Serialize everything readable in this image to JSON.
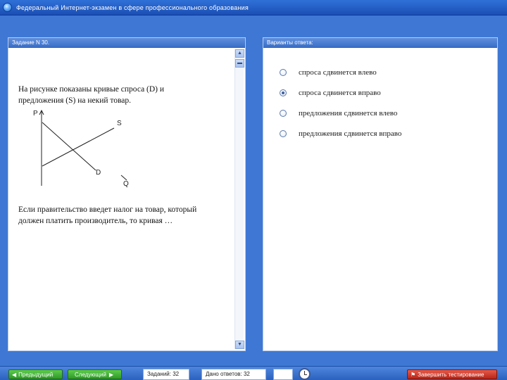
{
  "window": {
    "title": "Федеральный Интернет-экзамен в сфере профессионального образования",
    "icon": "app-globe-icon"
  },
  "task_panel": {
    "header": "Задание N 30.",
    "question_intro": "На рисунке показаны кривые спроса (D) и предложения (S) на некий товар.",
    "graph_labels": {
      "price": "P",
      "supply": "S",
      "demand": "D",
      "quantity": "Q"
    },
    "question_body": "Если правительство введет налог на товар, который должен платить производитель, то кривая …"
  },
  "answers_panel": {
    "header": "Варианты ответа:",
    "options": [
      {
        "label": "спроса сдвинется влево",
        "checked": false
      },
      {
        "label": "спроса сдвинется вправо",
        "checked": true
      },
      {
        "label": "предложения сдвинется влево",
        "checked": false
      },
      {
        "label": "предложения сдвинется вправо",
        "checked": false
      }
    ]
  },
  "toolbar": {
    "prev_label": "Предыдущий",
    "next_label": "Следующий",
    "tasks_count": "Заданий: 32",
    "answered_count": "Дано ответов: 32",
    "finish_label": "Завершить тестирование"
  },
  "colors": {
    "titlebar": "#1b4fb4",
    "background": "#3e78d4",
    "green_button": "#2e9a27",
    "red_button": "#b82518"
  }
}
